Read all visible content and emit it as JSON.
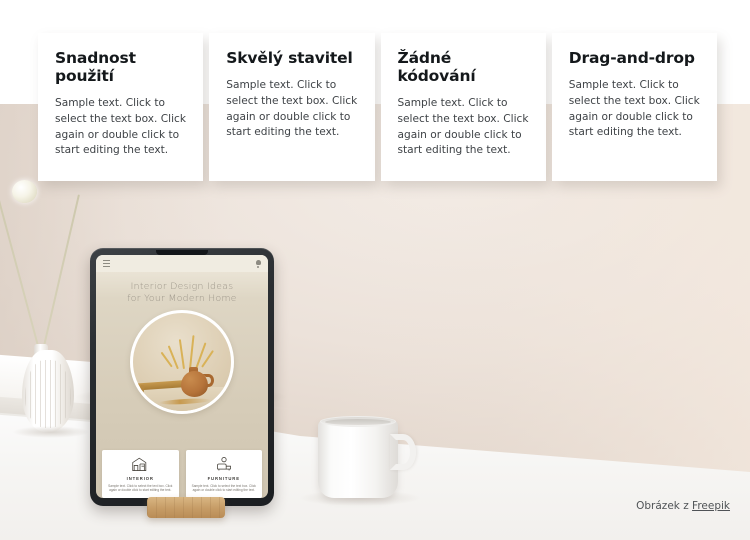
{
  "feature_cards": [
    {
      "title": "Snadnost použití",
      "text": "Sample text. Click to select the text box. Click again or double click to start editing the text."
    },
    {
      "title": "Skvělý stavitel",
      "text": "Sample text. Click to select the text box. Click again or double click to start editing the text."
    },
    {
      "title": "Žádné kódování",
      "text": "Sample text. Click to select the text box. Click again or double click to start editing the text."
    },
    {
      "title": "Drag-and-drop",
      "text": "Sample text. Click to select the text box. Click again or double click to start editing the text."
    }
  ],
  "tablet": {
    "topbar": {
      "menu_icon": "hamburger-icon",
      "notification_icon": "bell-icon"
    },
    "headline_line1": "Interior Design Ideas",
    "headline_line2": "for Your Modern Home",
    "hero_image_alt": "terracotta-jug-with-dried-flowers",
    "tiles": [
      {
        "icon": "interior-room-icon",
        "label": "INTERIOR",
        "text": "Sample text. Click to select the text box. Click again or double click to start editing the text."
      },
      {
        "icon": "furniture-sofa-icon",
        "label": "FURNITURE",
        "text": "Sample text. Click to select the text box. Click again or double click to start editing the text."
      }
    ]
  },
  "attribution": {
    "prefix": "Obrázek z ",
    "link_label": "Freepik"
  },
  "colors": {
    "card_background": "#ffffff",
    "card_title": "#14181b",
    "card_text": "#3e4246",
    "wall": "#e7ddd3",
    "desk": "#fbfbfa",
    "tablet_frame": "#2b2f33",
    "screen_background": "#d6ccb8",
    "screen_topbar": "#f0ece1",
    "stand_wood": "#c79d67",
    "attribution_text": "#4f5356"
  }
}
